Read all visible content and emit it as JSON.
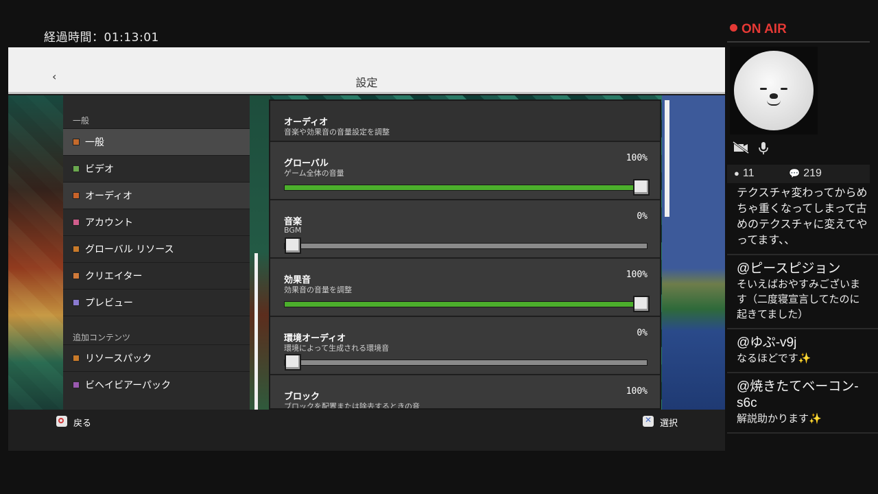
{
  "stream": {
    "elapsed": "経過時間：01:13:01",
    "onair": "ON AIR",
    "viewers": "11",
    "comments_count": "219"
  },
  "settings": {
    "title": "設定",
    "sidebar": {
      "group_general": "一般",
      "items": [
        {
          "label": "一般",
          "color": "#c46a2c"
        },
        {
          "label": "ビデオ",
          "color": "#6aa84f"
        },
        {
          "label": "オーディオ",
          "color": "#c8632a"
        },
        {
          "label": "アカウント",
          "color": "#d05d8c"
        },
        {
          "label": "グローバル リソース",
          "color": "#c87a2a"
        },
        {
          "label": "クリエイター",
          "color": "#d07a3a"
        },
        {
          "label": "プレビュー",
          "color": "#8a7ad0"
        }
      ],
      "group_extra": "追加コンテンツ",
      "extra_items": [
        {
          "label": "リソースパック",
          "color": "#c87a2a"
        },
        {
          "label": "ビヘイビアーパック",
          "color": "#9a5ab0"
        }
      ]
    },
    "audio": {
      "title": "オーディオ",
      "subtitle": "音楽や効果音の音量設定を調整",
      "sliders": [
        {
          "title": "グローバル",
          "sub": "ゲーム全体の音量",
          "value": "100%",
          "level": 1.0
        },
        {
          "title": "音楽",
          "sub": "BGM",
          "value": "0%",
          "level": 0.0
        },
        {
          "title": "効果音",
          "sub": "効果音の音量を調整",
          "value": "100%",
          "level": 1.0
        },
        {
          "title": "環境オーディオ",
          "sub": "環境によって生成される環境音",
          "value": "0%",
          "level": 0.0
        },
        {
          "title": "ブロック",
          "sub": "ブロックを配置または除去するときの音",
          "value": "100%",
          "level": 1.0
        }
      ]
    },
    "footer": {
      "back": "戻る",
      "select": "選択"
    }
  },
  "chat": [
    {
      "user": "",
      "text": "テクスチャ変わってからめちゃ重くなってしまって古めのテクスチャに変えてやってます、、"
    },
    {
      "user": "@ピースピジョン",
      "text": "そいえばおやすみございます（二度寝宣言してたのに起きてました）"
    },
    {
      "user": "@ゆぷ-v9j",
      "text": "なるほどです✨"
    },
    {
      "user": "@焼きたてベーコン-s6c",
      "text": "解説助かります✨"
    }
  ]
}
